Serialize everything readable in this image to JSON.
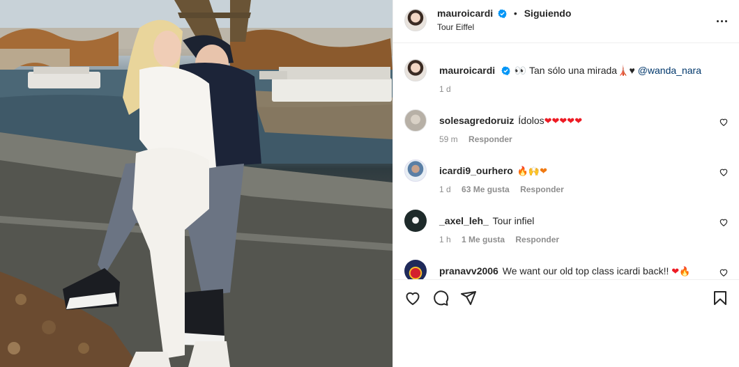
{
  "post": {
    "author": "mauroicardi",
    "follow_state": "Siguiendo",
    "location": "Tour Eiffel",
    "caption": {
      "username": "mauroicardi",
      "text": "👀 Tan sólo una mirada🗼♥",
      "mention": "@wanda_nara",
      "time": "1 d"
    }
  },
  "comments": [
    {
      "username": "solesagredoruiz",
      "text": "Ídolos",
      "emojis": "❤❤❤❤❤",
      "time": "59 m",
      "likes": "",
      "reply": "Responder"
    },
    {
      "username": "icardi9_ourhero",
      "text": "",
      "emojis": "🔥🙌❤",
      "time": "1 d",
      "likes": "63 Me gusta",
      "reply": "Responder"
    },
    {
      "username": "_axel_leh_",
      "text": "Tour infiel",
      "emojis": "",
      "time": "1 h",
      "likes": "1 Me gusta",
      "reply": "Responder"
    },
    {
      "username": "pranavv2006",
      "text": "We want our old top class icardi back!!",
      "emojis": "❤🔥",
      "time": "",
      "likes": "",
      "reply": ""
    }
  ],
  "icons": {
    "verified": "verified-badge-icon",
    "more": "more-options-icon",
    "like": "heart-icon",
    "comment": "comment-icon",
    "share": "send-icon",
    "save": "bookmark-icon"
  },
  "colors": {
    "verified_blue": "#0095f6",
    "mention": "#00376b",
    "meta": "#8e8e8e",
    "heart_emoji": "#ed1b24"
  }
}
